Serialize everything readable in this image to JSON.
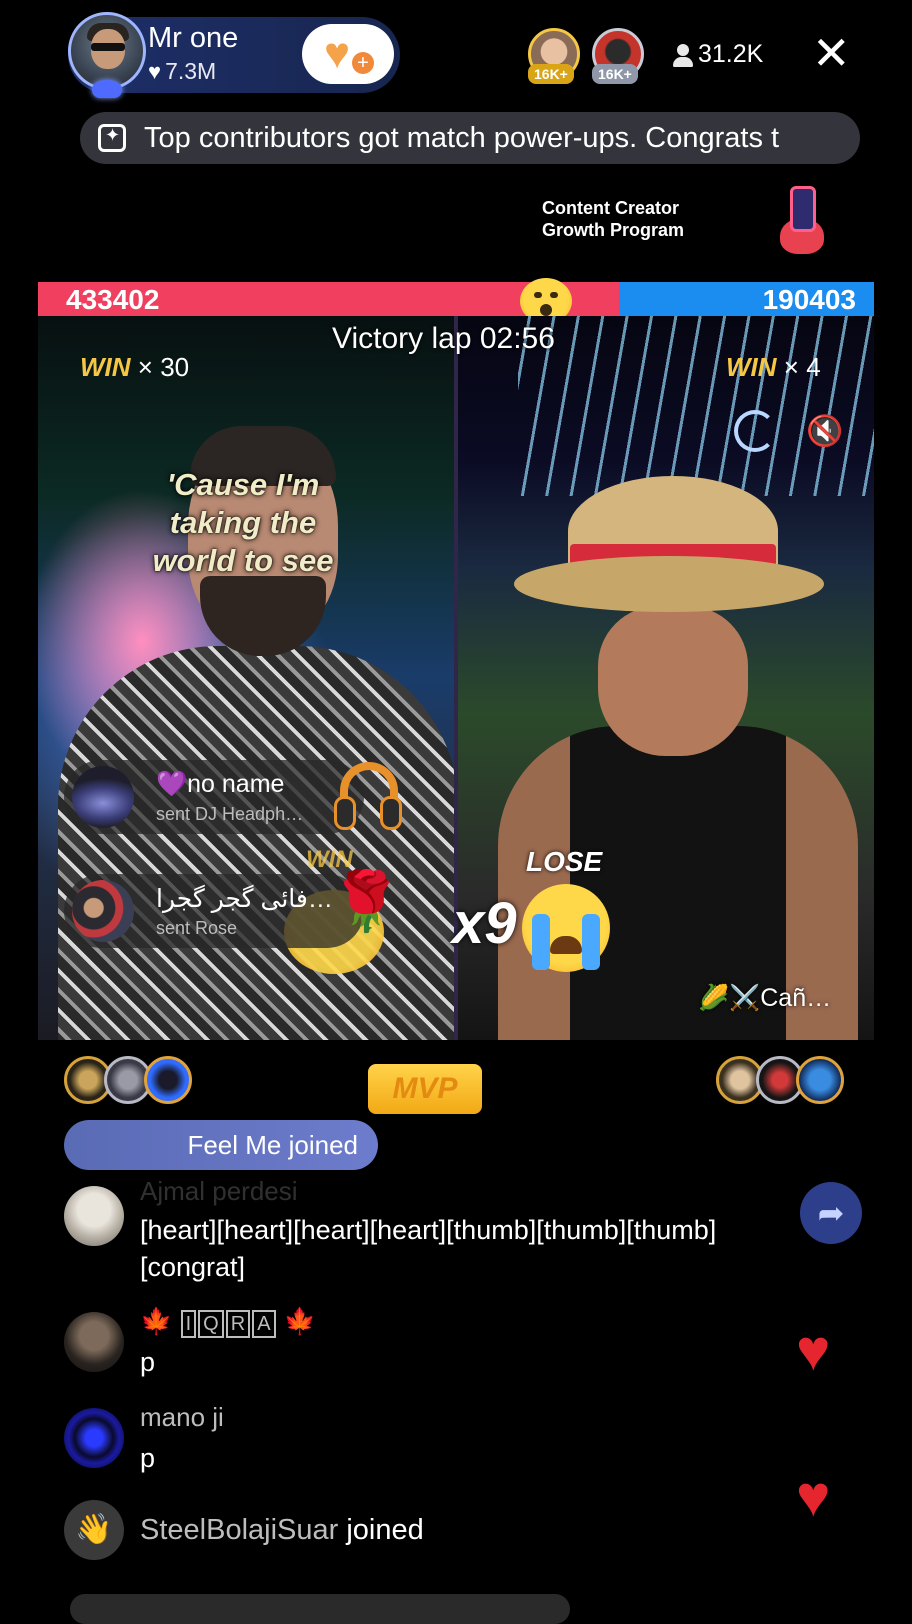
{
  "host": {
    "name": "Mr one",
    "likes": "7.3M"
  },
  "top_viewers": [
    {
      "badge": "16K+"
    },
    {
      "badge": "16K+"
    }
  ],
  "viewer_count": "31.2K",
  "close_symbol": "✕",
  "ticker": {
    "text": "Top contributors got match power-ups. Congrats t"
  },
  "creator_program": {
    "line1": "Content Creator",
    "line2": "Growth Program"
  },
  "battle": {
    "left_score": "433402",
    "right_score": "190403",
    "left_share": 0.695,
    "timer_label": "Victory lap 02:56",
    "left_win_word": "WIN",
    "left_win_multiplier": "× 30",
    "right_win_word": "WIN",
    "right_win_multiplier": "× 4",
    "lyric_lines": [
      "'Cause I'm",
      "taking the",
      "world to see"
    ],
    "lose_label": "LOSE",
    "lose_multiplier": "x9",
    "opponent_name": "🌽⚔️Cañ…",
    "colors": {
      "left": "#f03f5f",
      "right": "#1b8cf0"
    }
  },
  "gifts": [
    {
      "name": "💜no name",
      "sub": "sent DJ Headph…",
      "icon": "headphones-gift-icon"
    },
    {
      "name": "فائی گجر گجرا…",
      "sub": "sent Rose",
      "icon": "rose-gift-icon"
    }
  ],
  "win_stamp": "WIN",
  "mvp_label": "MVP",
  "joined_pill": "Feel Me joined",
  "chat": [
    {
      "name": "Ajmal perdesi",
      "message": "[heart][heart][heart][heart][thumb][thumb][thumb][congrat]"
    },
    {
      "name_boxed": [
        "I",
        "Q",
        "R",
        "A"
      ],
      "message": "p"
    },
    {
      "name": "mano ji",
      "message": "p"
    }
  ],
  "join_notice": {
    "user": "SteelBolajiSuar",
    "text": "joined"
  }
}
